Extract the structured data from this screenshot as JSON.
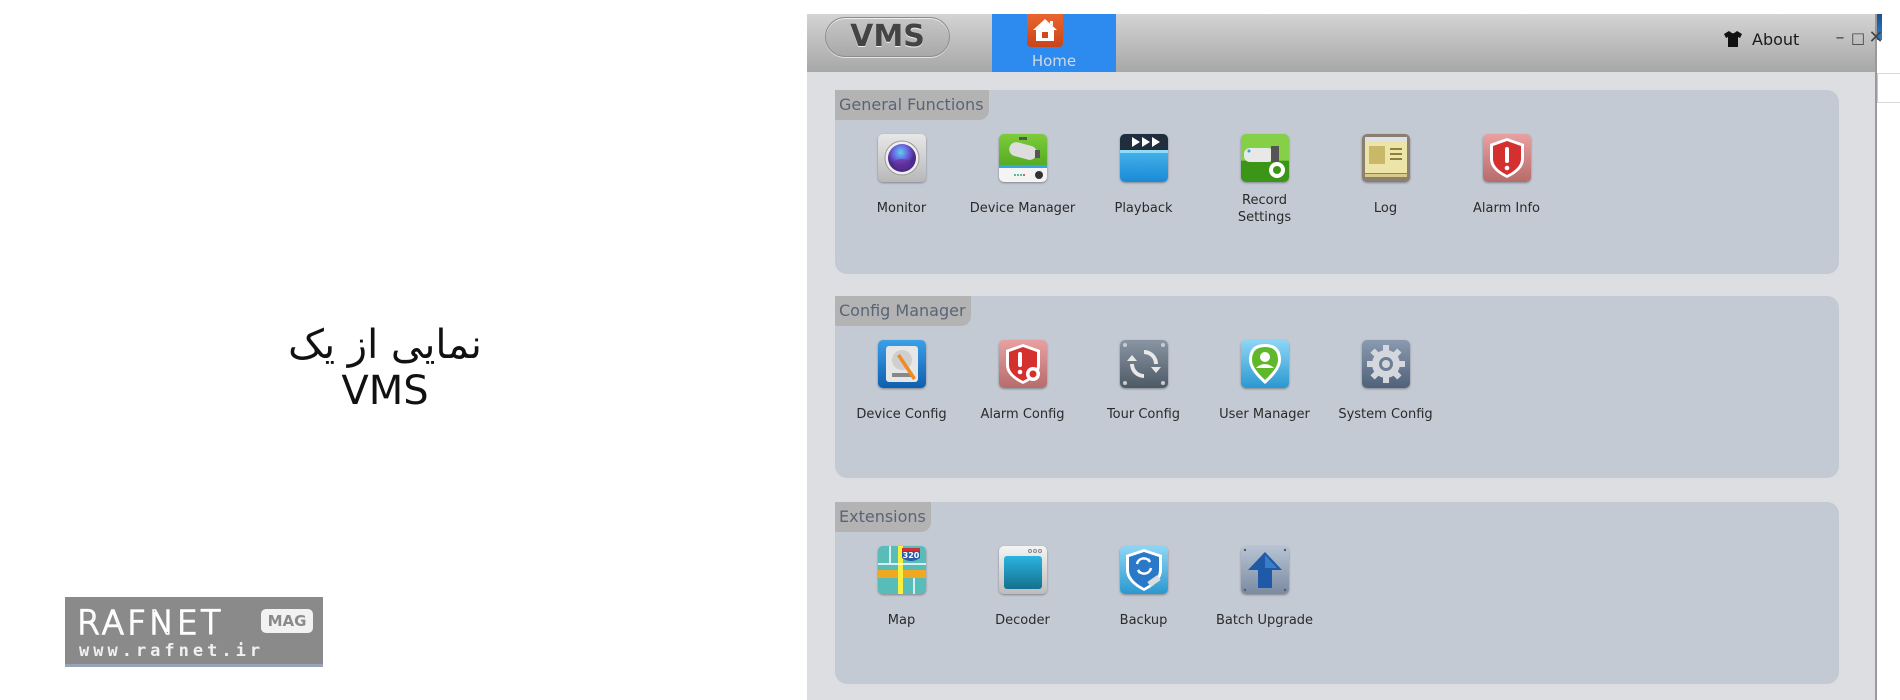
{
  "caption": "نمایی از یک VMS",
  "watermark": {
    "brand": "RAFNET",
    "badge": "MAG",
    "url": "www.rafnet.ir"
  },
  "window": {
    "logo_text": "VMS",
    "tabs": [
      {
        "label": "Home",
        "icon": "home-icon",
        "active": true
      }
    ],
    "about_label": "About",
    "about_icon": "tshirt-icon",
    "controls": {
      "minimize": "–",
      "maximize": "□",
      "close": "✕"
    }
  },
  "colors": {
    "active_tab": "#2d8bef",
    "home_icon": "#d9531e",
    "panel_bg": "#c4cad4",
    "content_bg": "#dcdee2",
    "section_header_bg": "#b3b3b3",
    "section_header_text": "#5a6478"
  },
  "sections": [
    {
      "title": "General Functions",
      "items": [
        {
          "label": "Monitor",
          "icon": "monitor-lens-icon"
        },
        {
          "label": "Device Manager",
          "icon": "device-manager-camera-icon"
        },
        {
          "label": "Playback",
          "icon": "playback-clapper-icon"
        },
        {
          "label": "Record\nSettings",
          "line1": "Record",
          "line2": "Settings",
          "icon": "record-settings-icon"
        },
        {
          "label": "Log",
          "icon": "log-icon"
        },
        {
          "label": "Alarm Info",
          "icon": "alarm-shield-icon"
        }
      ]
    },
    {
      "title": "Config Manager",
      "items": [
        {
          "label": "Device Config",
          "icon": "device-config-icon"
        },
        {
          "label": "Alarm Config",
          "icon": "alarm-config-icon"
        },
        {
          "label": "Tour Config",
          "icon": "tour-config-icon"
        },
        {
          "label": "User Manager",
          "icon": "user-manager-icon"
        },
        {
          "label": "System Config",
          "icon": "system-config-gear-icon"
        }
      ]
    },
    {
      "title": "Extensions",
      "items": [
        {
          "label": "Map",
          "icon": "map-icon",
          "badge": "320"
        },
        {
          "label": "Decoder",
          "icon": "decoder-icon"
        },
        {
          "label": "Backup",
          "icon": "backup-icon"
        },
        {
          "label": "Batch Upgrade",
          "icon": "batch-upgrade-arrow-icon"
        }
      ]
    }
  ]
}
